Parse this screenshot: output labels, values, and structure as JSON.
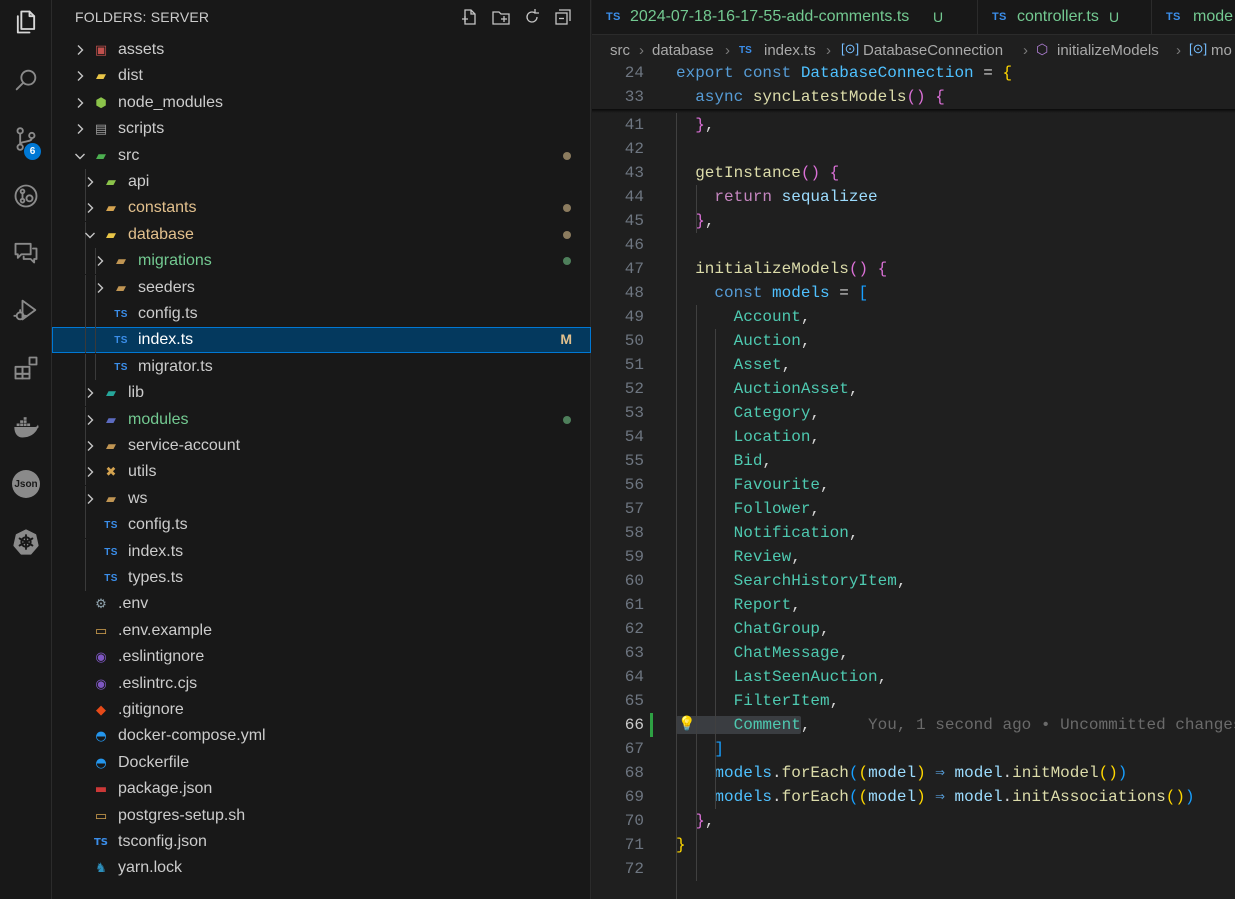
{
  "activity_bar": {
    "items": [
      {
        "name": "explorer-icon",
        "icon": "files"
      },
      {
        "name": "search-icon",
        "icon": "search"
      },
      {
        "name": "source-control-icon",
        "icon": "git-branch",
        "badge": "6"
      },
      {
        "name": "git-history-icon",
        "icon": "git-lens"
      },
      {
        "name": "comments-icon",
        "icon": "comment-discussion"
      },
      {
        "name": "run-debug-icon",
        "icon": "debug-alt"
      },
      {
        "name": "extensions-icon",
        "icon": "extensions"
      },
      {
        "name": "docker-icon",
        "icon": "docker"
      },
      {
        "name": "json-icon",
        "icon": "json",
        "label": "Json"
      },
      {
        "name": "kubernetes-icon",
        "icon": "kubernetes"
      }
    ]
  },
  "sidebar": {
    "title": "FOLDERS: SERVER",
    "tree": [
      {
        "label": "assets",
        "kind": "folder",
        "depth": 0,
        "expanded": false,
        "icon": "folder-assets",
        "color": "#cccccc"
      },
      {
        "label": "dist",
        "kind": "folder",
        "depth": 0,
        "expanded": false,
        "icon": "folder-dist",
        "color": "#cccccc"
      },
      {
        "label": "node_modules",
        "kind": "folder",
        "depth": 0,
        "expanded": false,
        "icon": "folder-node",
        "color": "#cccccc"
      },
      {
        "label": "scripts",
        "kind": "folder",
        "depth": 0,
        "expanded": false,
        "icon": "folder-scripts",
        "color": "#cccccc"
      },
      {
        "label": "src",
        "kind": "folder",
        "depth": 0,
        "expanded": true,
        "icon": "folder-src",
        "color": "#cccccc",
        "dot": "#8b7b5e"
      },
      {
        "label": "api",
        "kind": "folder",
        "depth": 1,
        "expanded": false,
        "icon": "folder-api",
        "color": "#cccccc"
      },
      {
        "label": "constants",
        "kind": "folder",
        "depth": 1,
        "expanded": false,
        "icon": "folder-constants",
        "color": "#e2c08d",
        "dot": "#8b7b5e"
      },
      {
        "label": "database",
        "kind": "folder",
        "depth": 1,
        "expanded": true,
        "icon": "folder-database",
        "color": "#e2c08d",
        "dot": "#8b7b5e"
      },
      {
        "label": "migrations",
        "kind": "folder",
        "depth": 2,
        "expanded": false,
        "icon": "folder",
        "color": "#73c991",
        "dot": "#4e7f5b"
      },
      {
        "label": "seeders",
        "kind": "folder",
        "depth": 2,
        "expanded": false,
        "icon": "folder",
        "color": "#cccccc"
      },
      {
        "label": "config.ts",
        "kind": "ts",
        "depth": 2,
        "icon": "typescript",
        "color": "#cccccc"
      },
      {
        "label": "index.ts",
        "kind": "ts",
        "depth": 2,
        "icon": "typescript",
        "color": "#ffffff",
        "selected": true,
        "status": "M"
      },
      {
        "label": "migrator.ts",
        "kind": "ts",
        "depth": 2,
        "icon": "typescript",
        "color": "#cccccc"
      },
      {
        "label": "lib",
        "kind": "folder",
        "depth": 1,
        "expanded": false,
        "icon": "folder-lib",
        "color": "#cccccc"
      },
      {
        "label": "modules",
        "kind": "folder",
        "depth": 1,
        "expanded": false,
        "icon": "folder-modules",
        "color": "#73c991",
        "dot": "#4e7f5b"
      },
      {
        "label": "service-account",
        "kind": "folder",
        "depth": 1,
        "expanded": false,
        "icon": "folder",
        "color": "#cccccc"
      },
      {
        "label": "utils",
        "kind": "folder",
        "depth": 1,
        "expanded": false,
        "icon": "folder-utils",
        "color": "#cccccc"
      },
      {
        "label": "ws",
        "kind": "folder",
        "depth": 1,
        "expanded": false,
        "icon": "folder",
        "color": "#cccccc"
      },
      {
        "label": "config.ts",
        "kind": "ts",
        "depth": 1,
        "icon": "typescript",
        "color": "#cccccc"
      },
      {
        "label": "index.ts",
        "kind": "ts",
        "depth": 1,
        "icon": "typescript",
        "color": "#cccccc"
      },
      {
        "label": "types.ts",
        "kind": "ts",
        "depth": 1,
        "icon": "typescript",
        "color": "#cccccc"
      },
      {
        "label": ".env",
        "kind": "file",
        "depth": 0,
        "icon": "gear",
        "color": "#cccccc"
      },
      {
        "label": ".env.example",
        "kind": "file",
        "depth": 0,
        "icon": "terminal",
        "color": "#cccccc"
      },
      {
        "label": ".eslintignore",
        "kind": "file",
        "depth": 0,
        "icon": "eslint",
        "color": "#cccccc"
      },
      {
        "label": ".eslintrc.cjs",
        "kind": "file",
        "depth": 0,
        "icon": "eslint",
        "color": "#cccccc"
      },
      {
        "label": ".gitignore",
        "kind": "file",
        "depth": 0,
        "icon": "git",
        "color": "#cccccc"
      },
      {
        "label": "docker-compose.yml",
        "kind": "file",
        "depth": 0,
        "icon": "docker",
        "color": "#cccccc"
      },
      {
        "label": "Dockerfile",
        "kind": "file",
        "depth": 0,
        "icon": "docker",
        "color": "#cccccc"
      },
      {
        "label": "package.json",
        "kind": "file",
        "depth": 0,
        "icon": "npm",
        "color": "#cccccc"
      },
      {
        "label": "postgres-setup.sh",
        "kind": "file",
        "depth": 0,
        "icon": "terminal",
        "color": "#cccccc"
      },
      {
        "label": "tsconfig.json",
        "kind": "file",
        "depth": 0,
        "icon": "tsconfig",
        "color": "#cccccc"
      },
      {
        "label": "yarn.lock",
        "kind": "file",
        "depth": 0,
        "icon": "yarn",
        "color": "#cccccc"
      }
    ]
  },
  "editor": {
    "tabs": [
      {
        "icon": "TS",
        "name": "2024-07-18-16-17-55-add-comments.ts",
        "status": "U",
        "color": "#73c991"
      },
      {
        "icon": "TS",
        "name": "controller.ts",
        "status": "U",
        "color": "#73c991"
      },
      {
        "icon": "TS",
        "name": "mode",
        "status": "",
        "color": "#73c991"
      }
    ],
    "breadcrumb": [
      "src",
      "database",
      "TS",
      "index.ts",
      "DatabaseConnection",
      "initializeModels",
      "mo"
    ],
    "lines": [
      {
        "n": "24",
        "sticky": true,
        "tokens": [
          [
            "export ",
            "kw"
          ],
          [
            "const ",
            "kw"
          ],
          [
            "DatabaseConnection",
            "cn"
          ],
          [
            " = ",
            "pu"
          ],
          [
            "{",
            "b1"
          ]
        ]
      },
      {
        "n": "33",
        "sticky": true,
        "tokens": [
          [
            "  async ",
            "kw"
          ],
          [
            "syncLatestModels",
            "fn"
          ],
          [
            "(",
            "b2"
          ],
          [
            ")",
            "b2"
          ],
          [
            " ",
            "pu"
          ],
          [
            "{",
            "b2"
          ]
        ]
      },
      {
        "n": "41",
        "tokens": [
          [
            "  ",
            "pu"
          ],
          [
            "}",
            "b2"
          ],
          [
            ",",
            "pu"
          ]
        ]
      },
      {
        "n": "42",
        "tokens": []
      },
      {
        "n": "43",
        "tokens": [
          [
            "  getInstance",
            "fn"
          ],
          [
            "(",
            "b2"
          ],
          [
            ")",
            "b2"
          ],
          [
            " ",
            "pu"
          ],
          [
            "{",
            "b2"
          ]
        ]
      },
      {
        "n": "44",
        "tokens": [
          [
            "    return ",
            "kc"
          ],
          [
            "sequalizee",
            "vr"
          ]
        ]
      },
      {
        "n": "45",
        "tokens": [
          [
            "  ",
            "pu"
          ],
          [
            "}",
            "b2"
          ],
          [
            ",",
            "pu"
          ]
        ]
      },
      {
        "n": "46",
        "tokens": []
      },
      {
        "n": "47",
        "tokens": [
          [
            "  initializeModels",
            "fn"
          ],
          [
            "(",
            "b2"
          ],
          [
            ")",
            "b2"
          ],
          [
            " ",
            "pu"
          ],
          [
            "{",
            "b2"
          ]
        ]
      },
      {
        "n": "48",
        "tokens": [
          [
            "    const ",
            "kw"
          ],
          [
            "models",
            "cn"
          ],
          [
            " = ",
            "pu"
          ],
          [
            "[",
            "b3"
          ]
        ]
      },
      {
        "n": "49",
        "tokens": [
          [
            "      Account",
            "ty"
          ],
          [
            ",",
            "pu"
          ]
        ]
      },
      {
        "n": "50",
        "tokens": [
          [
            "      Auction",
            "ty"
          ],
          [
            ",",
            "pu"
          ]
        ]
      },
      {
        "n": "51",
        "tokens": [
          [
            "      Asset",
            "ty"
          ],
          [
            ",",
            "pu"
          ]
        ]
      },
      {
        "n": "52",
        "tokens": [
          [
            "      AuctionAsset",
            "ty"
          ],
          [
            ",",
            "pu"
          ]
        ]
      },
      {
        "n": "53",
        "tokens": [
          [
            "      Category",
            "ty"
          ],
          [
            ",",
            "pu"
          ]
        ]
      },
      {
        "n": "54",
        "tokens": [
          [
            "      Location",
            "ty"
          ],
          [
            ",",
            "pu"
          ]
        ]
      },
      {
        "n": "55",
        "tokens": [
          [
            "      Bid",
            "ty"
          ],
          [
            ",",
            "pu"
          ]
        ]
      },
      {
        "n": "56",
        "tokens": [
          [
            "      Favourite",
            "ty"
          ],
          [
            ",",
            "pu"
          ]
        ]
      },
      {
        "n": "57",
        "tokens": [
          [
            "      Follower",
            "ty"
          ],
          [
            ",",
            "pu"
          ]
        ]
      },
      {
        "n": "58",
        "tokens": [
          [
            "      Notification",
            "ty"
          ],
          [
            ",",
            "pu"
          ]
        ]
      },
      {
        "n": "59",
        "tokens": [
          [
            "      Review",
            "ty"
          ],
          [
            ",",
            "pu"
          ]
        ]
      },
      {
        "n": "60",
        "tokens": [
          [
            "      SearchHistoryItem",
            "ty"
          ],
          [
            ",",
            "pu"
          ]
        ]
      },
      {
        "n": "61",
        "tokens": [
          [
            "      Report",
            "ty"
          ],
          [
            ",",
            "pu"
          ]
        ]
      },
      {
        "n": "62",
        "tokens": [
          [
            "      ChatGroup",
            "ty"
          ],
          [
            ",",
            "pu"
          ]
        ]
      },
      {
        "n": "63",
        "tokens": [
          [
            "      ChatMessage",
            "ty"
          ],
          [
            ",",
            "pu"
          ]
        ]
      },
      {
        "n": "64",
        "tokens": [
          [
            "      LastSeenAuction",
            "ty"
          ],
          [
            ",",
            "pu"
          ]
        ]
      },
      {
        "n": "65",
        "tokens": [
          [
            "      FilterItem",
            "ty"
          ],
          [
            ",",
            "pu"
          ]
        ]
      },
      {
        "n": "66",
        "current": true,
        "tokens": [
          [
            "      Comment",
            "ty"
          ],
          [
            ",",
            "pu"
          ],
          [
            "      You, 1 second ago • Uncommitted changes",
            "blame"
          ]
        ]
      },
      {
        "n": "67",
        "tokens": [
          [
            "    ",
            "pu"
          ],
          [
            "]",
            "b3"
          ]
        ]
      },
      {
        "n": "68",
        "tokens": [
          [
            "    models",
            "cn"
          ],
          [
            ".",
            "pu"
          ],
          [
            "forEach",
            "fn"
          ],
          [
            "(",
            "b3"
          ],
          [
            "(",
            "b1"
          ],
          [
            "model",
            "vr"
          ],
          [
            ")",
            "b1"
          ],
          [
            " ⇒ ",
            "kw"
          ],
          [
            "model",
            "vr"
          ],
          [
            ".",
            "pu"
          ],
          [
            "initModel",
            "fn"
          ],
          [
            "(",
            "b1"
          ],
          [
            ")",
            "b1"
          ],
          [
            ")",
            "b3"
          ]
        ]
      },
      {
        "n": "69",
        "tokens": [
          [
            "    models",
            "cn"
          ],
          [
            ".",
            "pu"
          ],
          [
            "forEach",
            "fn"
          ],
          [
            "(",
            "b3"
          ],
          [
            "(",
            "b1"
          ],
          [
            "model",
            "vr"
          ],
          [
            ")",
            "b1"
          ],
          [
            " ⇒ ",
            "kw"
          ],
          [
            "model",
            "vr"
          ],
          [
            ".",
            "pu"
          ],
          [
            "initAssociations",
            "fn"
          ],
          [
            "(",
            "b1"
          ],
          [
            ")",
            "b1"
          ],
          [
            ")",
            "b3"
          ]
        ]
      },
      {
        "n": "70",
        "tokens": [
          [
            "  ",
            "pu"
          ],
          [
            "}",
            "b2"
          ],
          [
            ",",
            "pu"
          ]
        ]
      },
      {
        "n": "71",
        "tokens": [
          [
            "}",
            "b1"
          ]
        ]
      },
      {
        "n": "72",
        "tokens": []
      }
    ]
  }
}
